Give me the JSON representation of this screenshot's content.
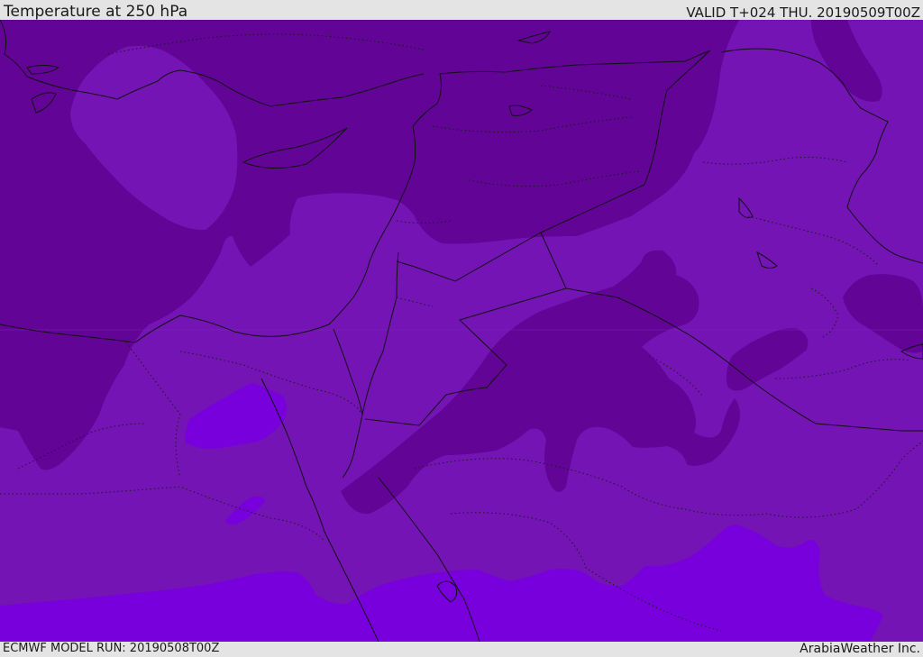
{
  "header": {
    "title": "Temperature at 250 hPa",
    "valid_time": "VALID T+024 THU. 20190509T00Z"
  },
  "footer": {
    "model_run": "ECMWF MODEL RUN: 20190508T00Z",
    "credit": "ArabiaWeather Inc."
  },
  "colors": {
    "field_mid": "#7414b4",
    "field_cold": "#620496",
    "field_warm": "#7800dc",
    "borders": "#111111",
    "bars": "#e4e4e4"
  }
}
